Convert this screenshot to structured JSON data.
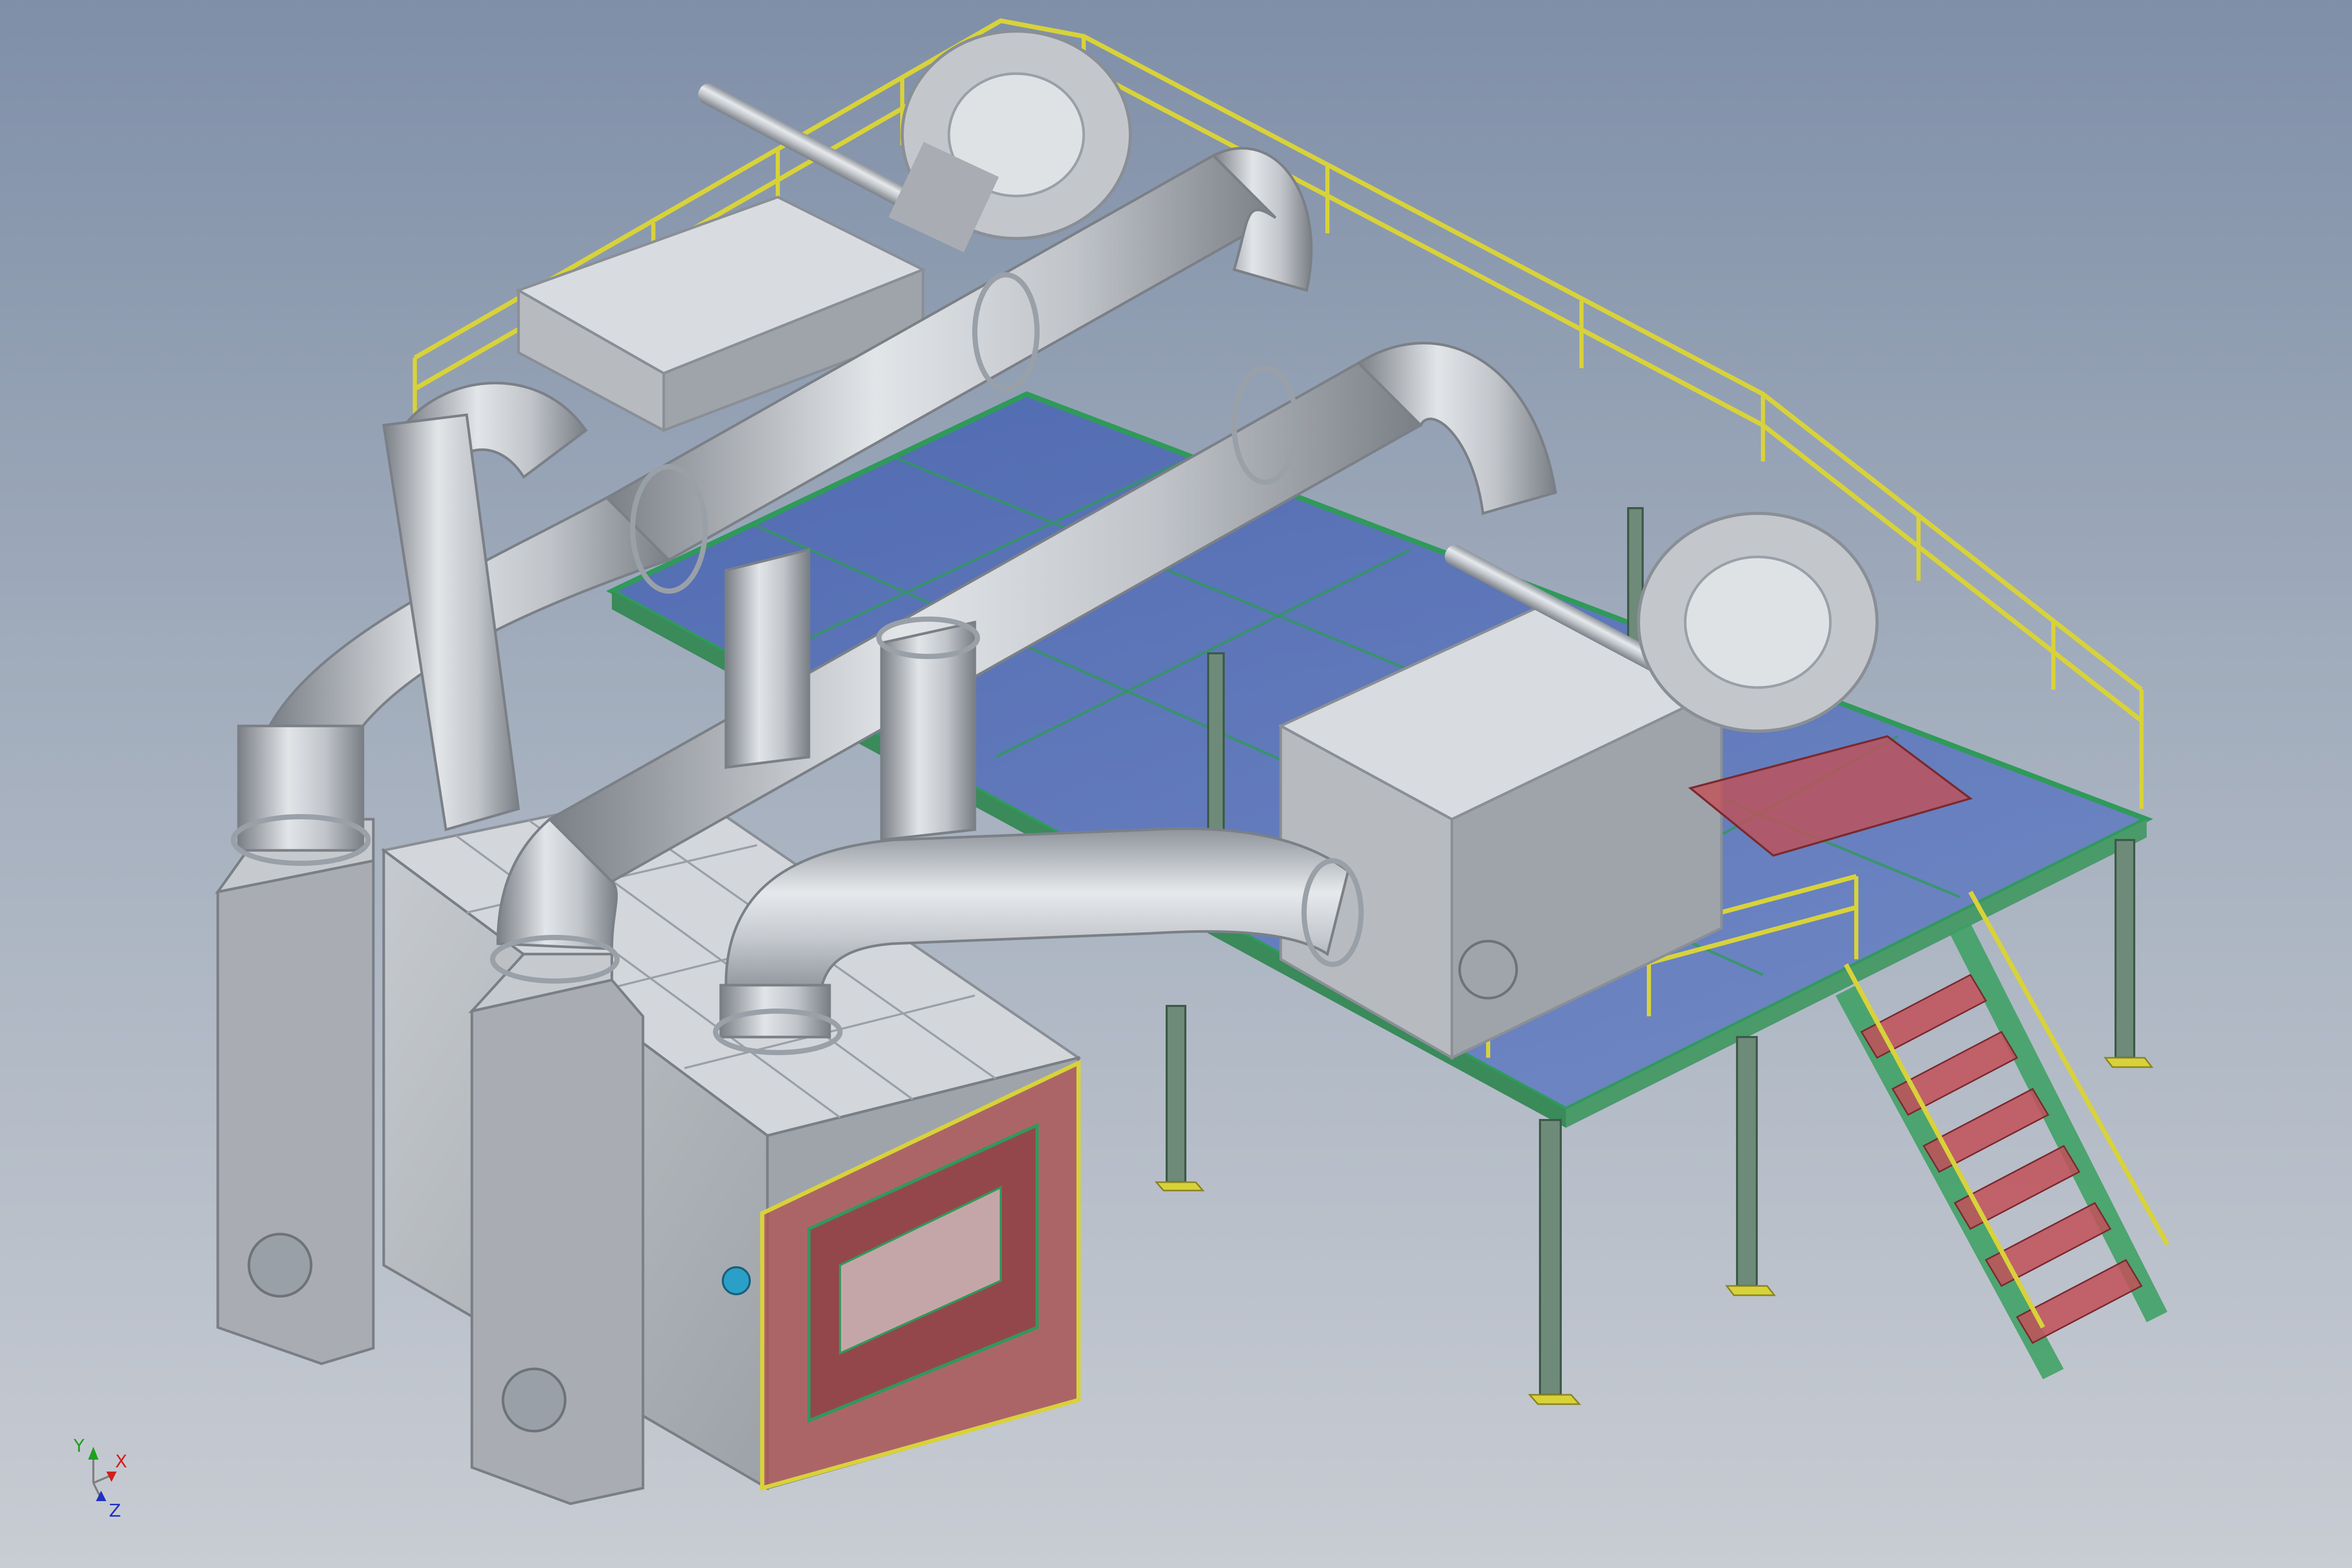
{
  "viewport": {
    "background_top": "#7f8fa8",
    "background_bottom": "#c8ccd3"
  },
  "colors": {
    "steel": "#b9bec4",
    "steel_dark": "#8a8f96",
    "railing": "#d8d23a",
    "deck_glass": "#3f5fb5",
    "frame_green": "#2f9a5a",
    "hot_red": "#c0505a",
    "flange": "#9aa0a8"
  },
  "view_triad": {
    "x_label": "X",
    "y_label": "Y",
    "z_label": "Z",
    "x_color": "#d02020",
    "y_color": "#20a020",
    "z_color": "#2030c0"
  },
  "model_icons": [
    "blower-icon",
    "duct-icon",
    "furnace-icon",
    "platform-icon",
    "stair-icon",
    "railing-icon"
  ]
}
